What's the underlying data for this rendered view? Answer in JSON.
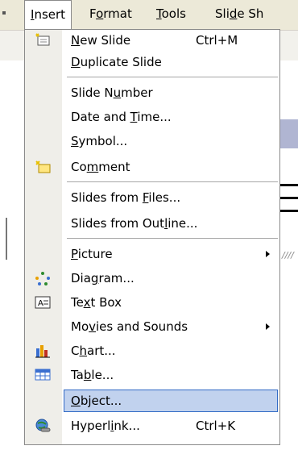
{
  "menubar": {
    "items": [
      {
        "label_pre": "",
        "label_u": "I",
        "label_post": "nsert"
      },
      {
        "label_pre": "F",
        "label_u": "o",
        "label_post": "rmat"
      },
      {
        "label_pre": "",
        "label_u": "T",
        "label_post": "ools"
      },
      {
        "label_pre": "Sli",
        "label_u": "d",
        "label_post": "e Sh"
      }
    ]
  },
  "menu": {
    "items": [
      {
        "pre": "",
        "u": "N",
        "post": "ew Slide",
        "shortcut": "Ctrl+M",
        "icon": "new-slide-icon"
      },
      {
        "pre": "",
        "u": "D",
        "post": "uplicate Slide",
        "shortcut": "",
        "icon": ""
      },
      {
        "pre": "Slide N",
        "u": "u",
        "post": "mber",
        "shortcut": "",
        "icon": ""
      },
      {
        "pre": "Date and ",
        "u": "T",
        "post": "ime...",
        "shortcut": "",
        "icon": ""
      },
      {
        "pre": "",
        "u": "S",
        "post": "ymbol...",
        "shortcut": "",
        "icon": ""
      },
      {
        "pre": "Co",
        "u": "m",
        "post": "ment",
        "shortcut": "",
        "icon": "comment-icon"
      },
      {
        "pre": "Slides from ",
        "u": "F",
        "post": "iles...",
        "shortcut": "",
        "icon": ""
      },
      {
        "pre": "Slides from Out",
        "u": "l",
        "post": "ine...",
        "shortcut": "",
        "icon": ""
      },
      {
        "pre": "",
        "u": "P",
        "post": "icture",
        "shortcut": "",
        "icon": "",
        "submenu": true
      },
      {
        "pre": "Dia",
        "u": "g",
        "post": "ram...",
        "shortcut": "",
        "icon": "diagram-icon"
      },
      {
        "pre": "Te",
        "u": "x",
        "post": "t Box",
        "shortcut": "",
        "icon": "text-box-icon"
      },
      {
        "pre": "Mo",
        "u": "v",
        "post": "ies and Sounds",
        "shortcut": "",
        "icon": "",
        "submenu": true
      },
      {
        "pre": "C",
        "u": "h",
        "post": "art...",
        "shortcut": "",
        "icon": "chart-icon"
      },
      {
        "pre": "Ta",
        "u": "b",
        "post": "le...",
        "shortcut": "",
        "icon": "table-icon"
      },
      {
        "pre": "",
        "u": "O",
        "post": "bject...",
        "shortcut": "",
        "icon": "",
        "selected": true
      },
      {
        "pre": "Hyperl",
        "u": "i",
        "post": "nk...",
        "shortcut": "Ctrl+K",
        "icon": "hyperlink-icon"
      }
    ]
  },
  "colors": {
    "menubar_bg": "#ece9d8",
    "gutter_bg": "#efeee9",
    "selection_bg": "#c1d2ee",
    "selection_border": "#316ac5"
  }
}
